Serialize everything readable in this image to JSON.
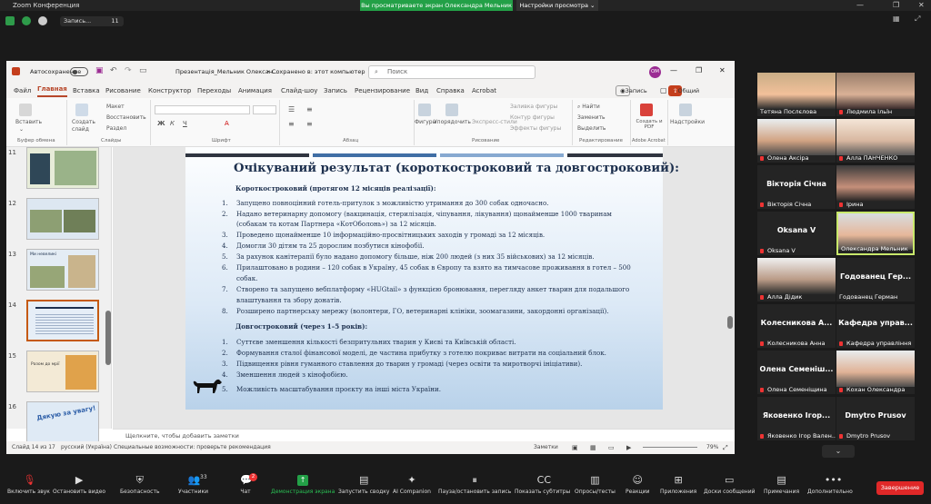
{
  "zoom": {
    "app_title": "Zoom Конференция",
    "share_banner": "Вы просматриваете экран Олександра Мельник",
    "view_options": "Настройки просмотра",
    "record_label": "Запись...",
    "record_counter": "11"
  },
  "ppt": {
    "autosave": "Автосохранение",
    "filename": "Презентація_Мельник Олексан...",
    "saved": "• Сохранено в: этот компьютер",
    "search_placeholder": "Поиск",
    "user_initials": "OM",
    "tabs": [
      "Файл",
      "Главная",
      "Вставка",
      "Рисование",
      "Конструктор",
      "Переходы",
      "Анимация",
      "Слайд-шоу",
      "Запись",
      "Рецензирование",
      "Вид",
      "Справка",
      "Acrobat"
    ],
    "record_btn": "Запись",
    "share_btn": "Общий доступ",
    "ribbon": {
      "paste": "Вставить",
      "clipboard": "Буфер обмена",
      "create": "Создать",
      "slide": "слайд",
      "layout": "Макет",
      "reset": "Восстановить",
      "section": "Раздел",
      "slides": "Слайды",
      "font": "Шрифт",
      "paragraph": "Абзац",
      "shapes": "Фигуры",
      "arrange": "Упорядочить",
      "quick_styles": "Экспресс-стили",
      "fill": "Заливка фигуры",
      "outline": "Контур фигуры",
      "effects": "Эффекты фигуры",
      "drawing": "Рисование",
      "find": "Найти",
      "replace": "Заменить",
      "select": "Выделить",
      "editing": "Редактирование",
      "create_pdf": "Создать и PDF",
      "acrobat": "Adobe Acrobat",
      "addins": "Надстройки"
    },
    "thumb_numbers": [
      "11",
      "12",
      "13",
      "14",
      "15",
      "16"
    ],
    "thumb_text": {
      "t13": "Ми невеликі",
      "t15": "Разом до мрії",
      "t16": "Дякую за увагу!"
    },
    "notes": "Щелкните, чтобы добавить заметки",
    "status": {
      "slide": "Слайд 14 из 17",
      "lang": "русский (Україна)",
      "access": "Специальные возможности: проверьте рекомендация",
      "notes_btn": "Заметки",
      "zoom": "79%"
    }
  },
  "slide": {
    "title": "Очікуваний результат (короткостроковий та довгостроковий):",
    "short_head": "Короткостроковий (протягом 12 місяців реалізації):",
    "short_items": [
      "Запущено повноцінний готель-притулок з можливістю утримання до 300 собак одночасно.",
      "Надано ветеринарну допомогу (вакцинація, стерилізація, чіпування, лікування) щонайменше 1000 тваринам",
      "(собакам та котам Партнера «КотОболонь») за 12 місяців.",
      "Проведено щонайменше 10 інформаційно-просвітницьких заходів у громаді за 12 місяців.",
      "Домогли 30 дітям та 25 дорослим позбутися кінофобії.",
      "За рахунок канітерапії було надано допомогу більше, ніж 200 людей (з них 35 військових) за 12 місяців.",
      "Прилаштовано в родини – 120 собак в Україну, 45 собак в Європу та взято на тимчасове проживання в готел – 500",
      "собак.",
      "Створено та запущено вебплатформу «HUGtail» з функцією бронювання, перегляду анкет тварин для подальшого",
      "влаштування та збору донатів.",
      "Розширено партнерську мережу (волонтери, ГО, ветеринарні клініки, зоомагазини, закордонні організації)."
    ],
    "short_nums": [
      "1.",
      "2.",
      "",
      "3.",
      "4.",
      "5.",
      "6.",
      "",
      "7.",
      "",
      "8."
    ],
    "long_head": "Довгостроковий (через 1–5 років):",
    "long_items": [
      "Суттєве зменшення кількості безпритульних тварин у Києві та Київській області.",
      "Формування сталої фінансової моделі, де частина прибутку з готелю покриває витрати на соціальний блок.",
      "Підвищення рівня гуманного ставлення до тварин у громаді (через освіти та миротворчі ініціативи).",
      "Зменшення людей з кінофобією.",
      "Можливість масштабування проєкту на інші міста України."
    ],
    "long_nums": [
      "1.",
      "2.",
      "3.",
      "4.",
      "5."
    ]
  },
  "participants": [
    {
      "name": "Тетяна Послєлова",
      "big": ""
    },
    {
      "name": "Людмила Ільїн",
      "big": ""
    },
    {
      "name": "Олена Аксіра",
      "big": ""
    },
    {
      "name": "Алла ПАНЧЕНКО",
      "big": ""
    },
    {
      "name": "Вікторія Січна",
      "big": "Вікторія Січна"
    },
    {
      "name": "Ірина",
      "big": ""
    },
    {
      "name": "Oksana V",
      "big": "Oksana V"
    },
    {
      "name": "Олександра Мельник",
      "big": ""
    },
    {
      "name": "Алла Дідик",
      "big": ""
    },
    {
      "name": "Годованец Герман",
      "big": "Годованец Гер..."
    },
    {
      "name": "Колесникова Анна",
      "big": "Колесникова А..."
    },
    {
      "name": "Кафедра управління",
      "big": "Кафедра управ..."
    },
    {
      "name": "Олена Семеніщина",
      "big": "Олена Семеніш..."
    },
    {
      "name": "Кохан Олександра",
      "big": ""
    },
    {
      "name": "Яковенко Ігор Вален...",
      "big": "Яковенко Ігор..."
    },
    {
      "name": "Dmytro Prusov",
      "big": "Dmytro Prusov"
    }
  ],
  "toolbar": {
    "unmute": "Включить звук",
    "video": "Остановить видео",
    "security": "Безопасность",
    "participants": "Участники",
    "participants_count": "33",
    "chat": "Чат",
    "chat_badge": "2",
    "share": "Демонстрация экрана",
    "summary": "Запустить сводку",
    "companion": "AI Companion",
    "pause": "Пауза/остановить запись",
    "subtitles": "Показать субтитры",
    "polls": "Опросы/тесты",
    "reactions": "Реакции",
    "apps": "Приложения",
    "whiteboards": "Доски сообщений",
    "notes": "Примечания",
    "more": "Дополнительно",
    "end": "Завершение"
  }
}
